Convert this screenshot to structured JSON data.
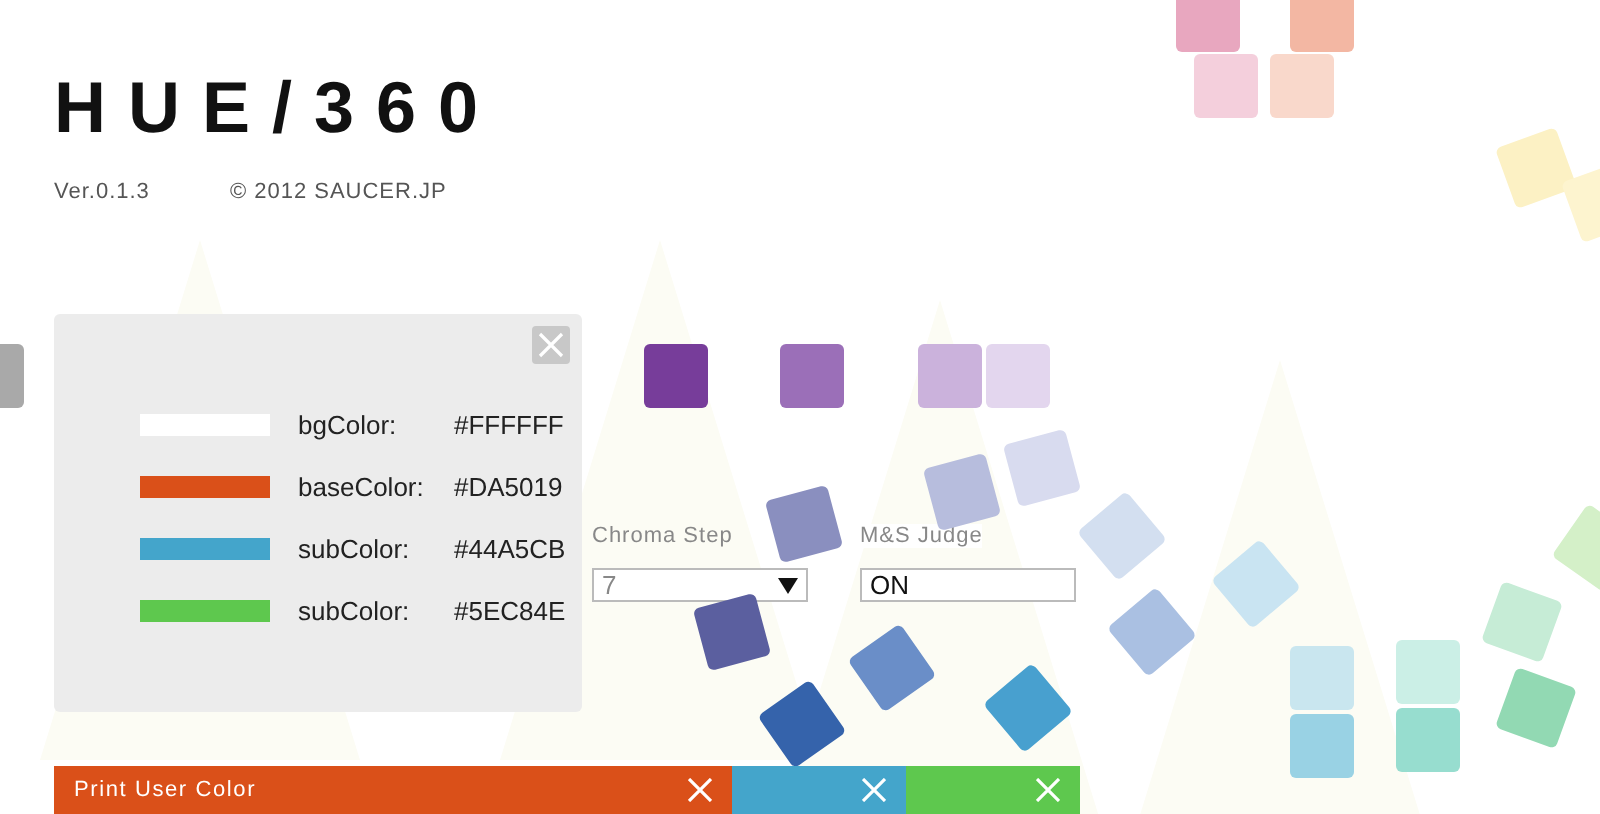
{
  "header": {
    "title": "HUE/360",
    "version": "Ver.0.1.3",
    "copyright": "© 2012 SAUCER.JP"
  },
  "controller": {
    "fields": [
      {
        "label": "Chroma Step",
        "value": "7",
        "kind": "select"
      },
      {
        "label": "M&S Judge",
        "value": "ON",
        "kind": "plain"
      }
    ]
  },
  "user_colors": [
    {
      "label": "bgColor:",
      "value": "#FFFFFF",
      "color": "#ffffff"
    },
    {
      "label": "baseColor:",
      "value": "#DA5019",
      "color": "#da5019"
    },
    {
      "label": "subColor:",
      "value": "#44A5CB",
      "color": "#44a5cb"
    },
    {
      "label": "subColor:",
      "value": "#5EC84E",
      "color": "#5ec84e"
    }
  ],
  "print_bar": [
    {
      "label": "Print User Color",
      "color": "#da5019"
    },
    {
      "color": "#44a5cb"
    },
    {
      "color": "#5ec84e"
    }
  ]
}
